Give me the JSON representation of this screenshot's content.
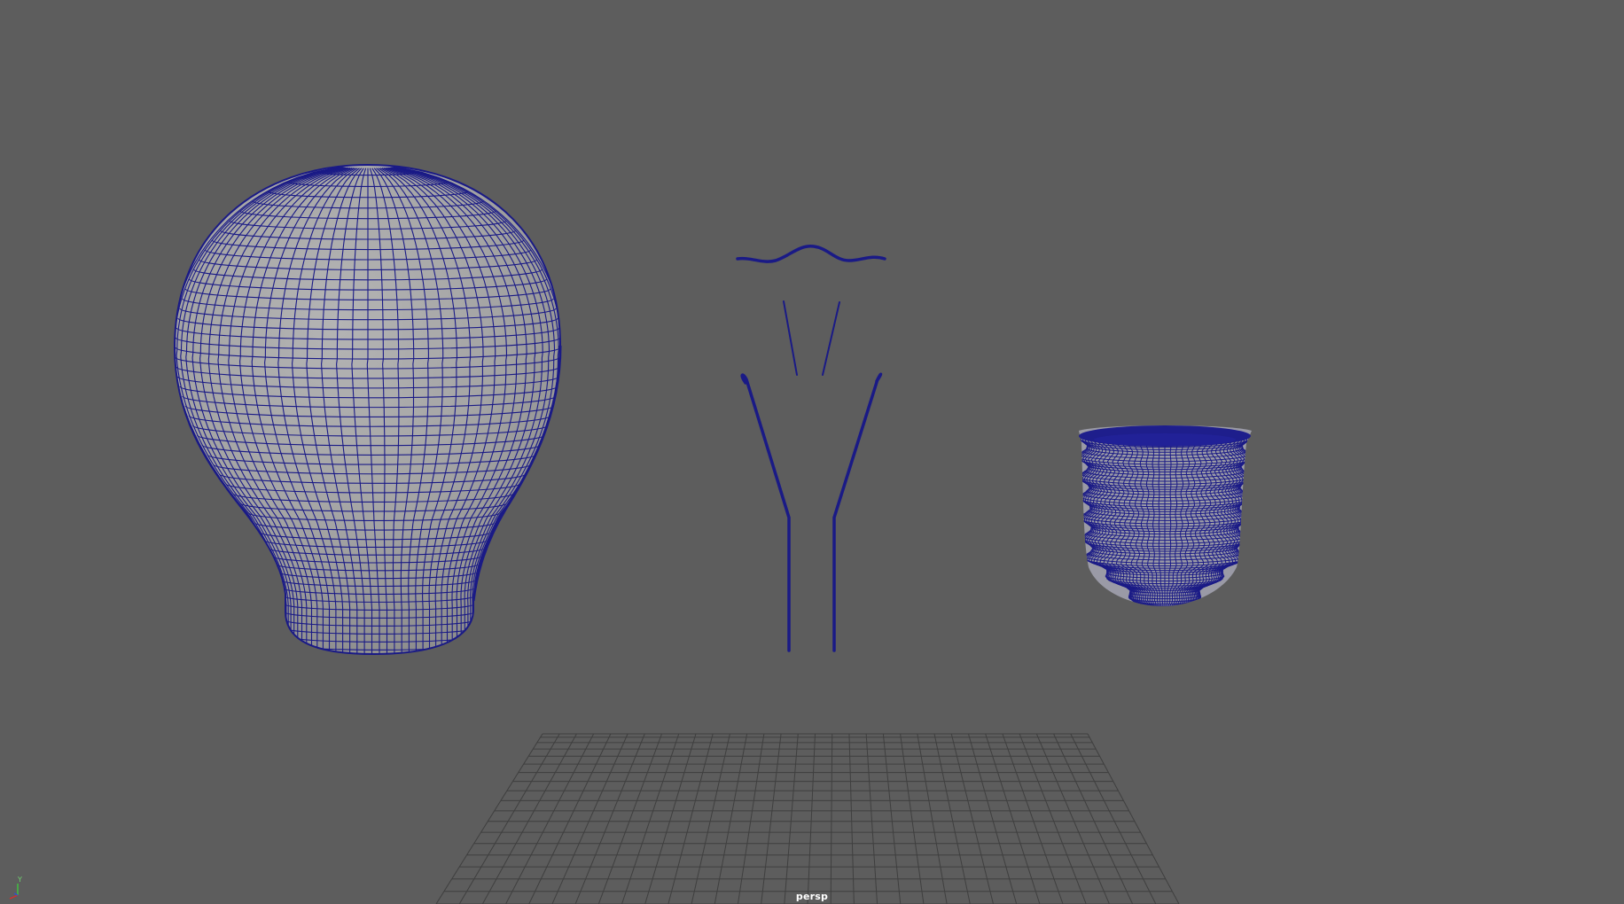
{
  "viewport": {
    "camera_name": "persp",
    "background_color": "#5d5d5d",
    "wire_color": "#1a1a86",
    "bulb_fill_color": "#a3a3a3",
    "grid_color": "#3f3f3f"
  },
  "scene_objects": [
    {
      "name": "glass-bulb",
      "shading": "wireframe-on-shaded"
    },
    {
      "name": "filament",
      "shading": "wireframe"
    },
    {
      "name": "support-wires",
      "shading": "wireframe"
    },
    {
      "name": "lead-wires",
      "shading": "wireframe"
    },
    {
      "name": "screw-base",
      "shading": "wireframe-on-shaded"
    }
  ],
  "axis_gizmo": {
    "y_label": "Y",
    "x_color": "#d03030",
    "y_color": "#40c040",
    "z_color": "#3050d0"
  }
}
